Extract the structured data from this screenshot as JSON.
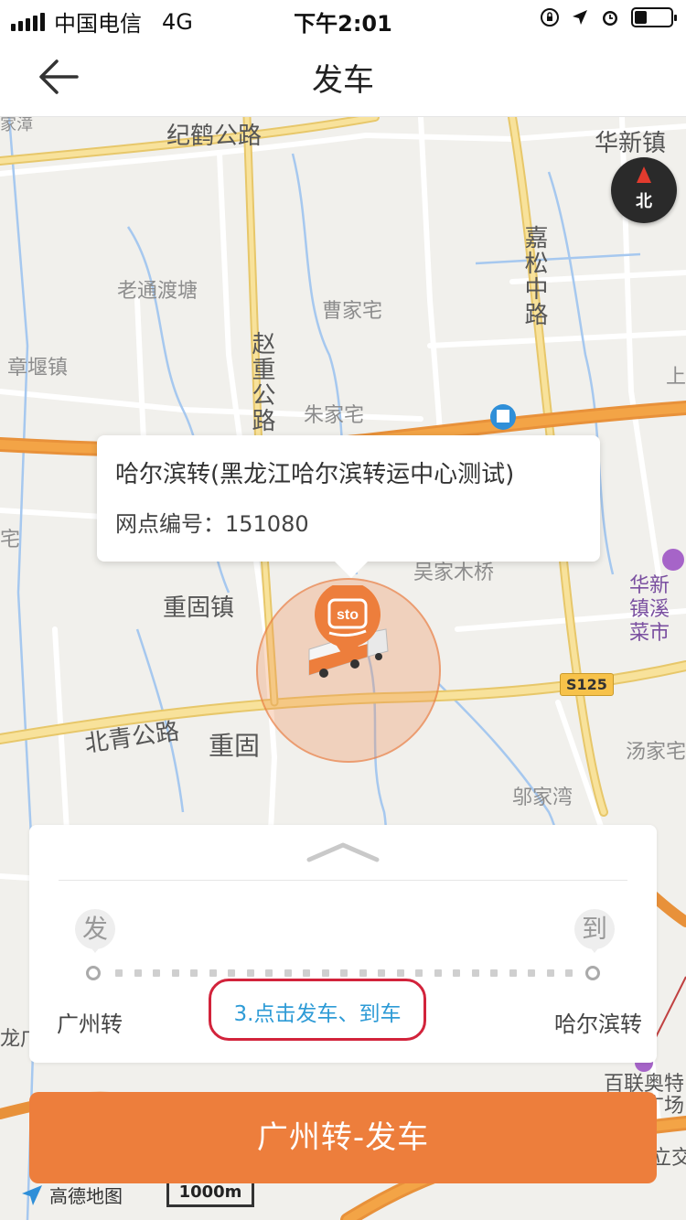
{
  "status_bar": {
    "carrier": "中国电信",
    "network": "4G",
    "time": "下午2:01",
    "battery_level": 0.35
  },
  "nav": {
    "title": "发车",
    "back_icon": "arrow-left-icon"
  },
  "map": {
    "places": {
      "jihe_road": "纪鹤公路",
      "huaxin_town": "华新镇",
      "laotong_dutang": "老通渡塘",
      "caojia_zhai": "曹家宅",
      "zhangyan_town": "章堰镇",
      "zhaochong_road": "赵重公路",
      "zhujia_zhai": "朱家宅",
      "jiasong_road": "嘉松中路",
      "wujia_muqiao": "吴家木桥",
      "chonggu_town": "重固镇",
      "beiqing_road": "北青公路",
      "chonggu": "重固",
      "huaxin_xicai": "华新镇溪菜市",
      "tangjia_zhai": "汤家宅",
      "wujia_wan": "邬家湾",
      "bailian": "百联奥特莱斯广场",
      "edge_zhai": "宅",
      "edge_shang": "上",
      "edge_long": "龙广",
      "edge_li": "立交",
      "edge_jiazao": "家漳",
      "s125": "S125"
    },
    "compass_label": "北",
    "popup": {
      "name": "哈尔滨转(黑龙江哈尔滨转运中心测试)",
      "code_label": "网点编号：",
      "code_value": "151080"
    },
    "provider": "高德地图",
    "scale": "1000m"
  },
  "route_card": {
    "start_badge": "发",
    "end_badge": "到",
    "start_name": "广州转",
    "end_name": "哈尔滨转",
    "annotation": "3.点击发车、到车"
  },
  "action_button": "广州转-发车",
  "colors": {
    "accent": "#ed7e3c",
    "annotation_border": "#d2233b",
    "annotation_text": "#2e9bd6"
  }
}
